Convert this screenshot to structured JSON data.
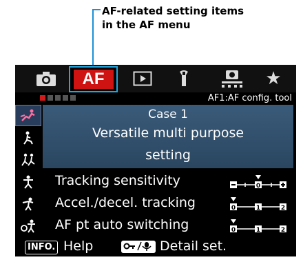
{
  "callout": {
    "line1": "AF-related setting items",
    "line2": "in the AF menu"
  },
  "tabs": [
    {
      "name": "camera",
      "icon": "camera-icon"
    },
    {
      "name": "af",
      "label": "AF",
      "active": true
    },
    {
      "name": "playback",
      "icon": "playback-icon"
    },
    {
      "name": "setup",
      "icon": "wrench-icon"
    },
    {
      "name": "custom",
      "icon": "custom-functions-icon"
    },
    {
      "name": "my-menu",
      "icon": "star-icon",
      "glyph": "★"
    }
  ],
  "subheader": {
    "page_dots": 5,
    "active_dot": 0,
    "page_label": "AF1:AF config. tool"
  },
  "cases": [
    {
      "icon": "case1-multipurpose-icon",
      "selected": true
    },
    {
      "icon": "case2-icon"
    },
    {
      "icon": "case3-icon"
    },
    {
      "icon": "case4-icon"
    },
    {
      "icon": "case5-icon"
    },
    {
      "icon": "case6-icon"
    }
  ],
  "case_detail": {
    "title": "Case 1",
    "desc_line1": "Versatile multi purpose",
    "desc_line2": "setting"
  },
  "settings": [
    {
      "label": "Tracking sensitivity",
      "scale": [
        "-",
        "0",
        "+"
      ],
      "value": 0
    },
    {
      "label": "Accel./decel. tracking",
      "scale": [
        "0",
        "1",
        "2"
      ],
      "value": 0
    },
    {
      "label": "AF pt auto switching",
      "scale": [
        "0",
        "1",
        "2"
      ],
      "value": 0
    }
  ],
  "footer": {
    "info_badge": "INFO.",
    "help": "Help",
    "key_badge": "O-n/₀",
    "detail": "Detail set."
  },
  "colors": {
    "af_tab": "#cf1212",
    "callout": "#1a8fd6",
    "case_bg": "#2f4d6b",
    "active_dot": "#d21a1a"
  }
}
